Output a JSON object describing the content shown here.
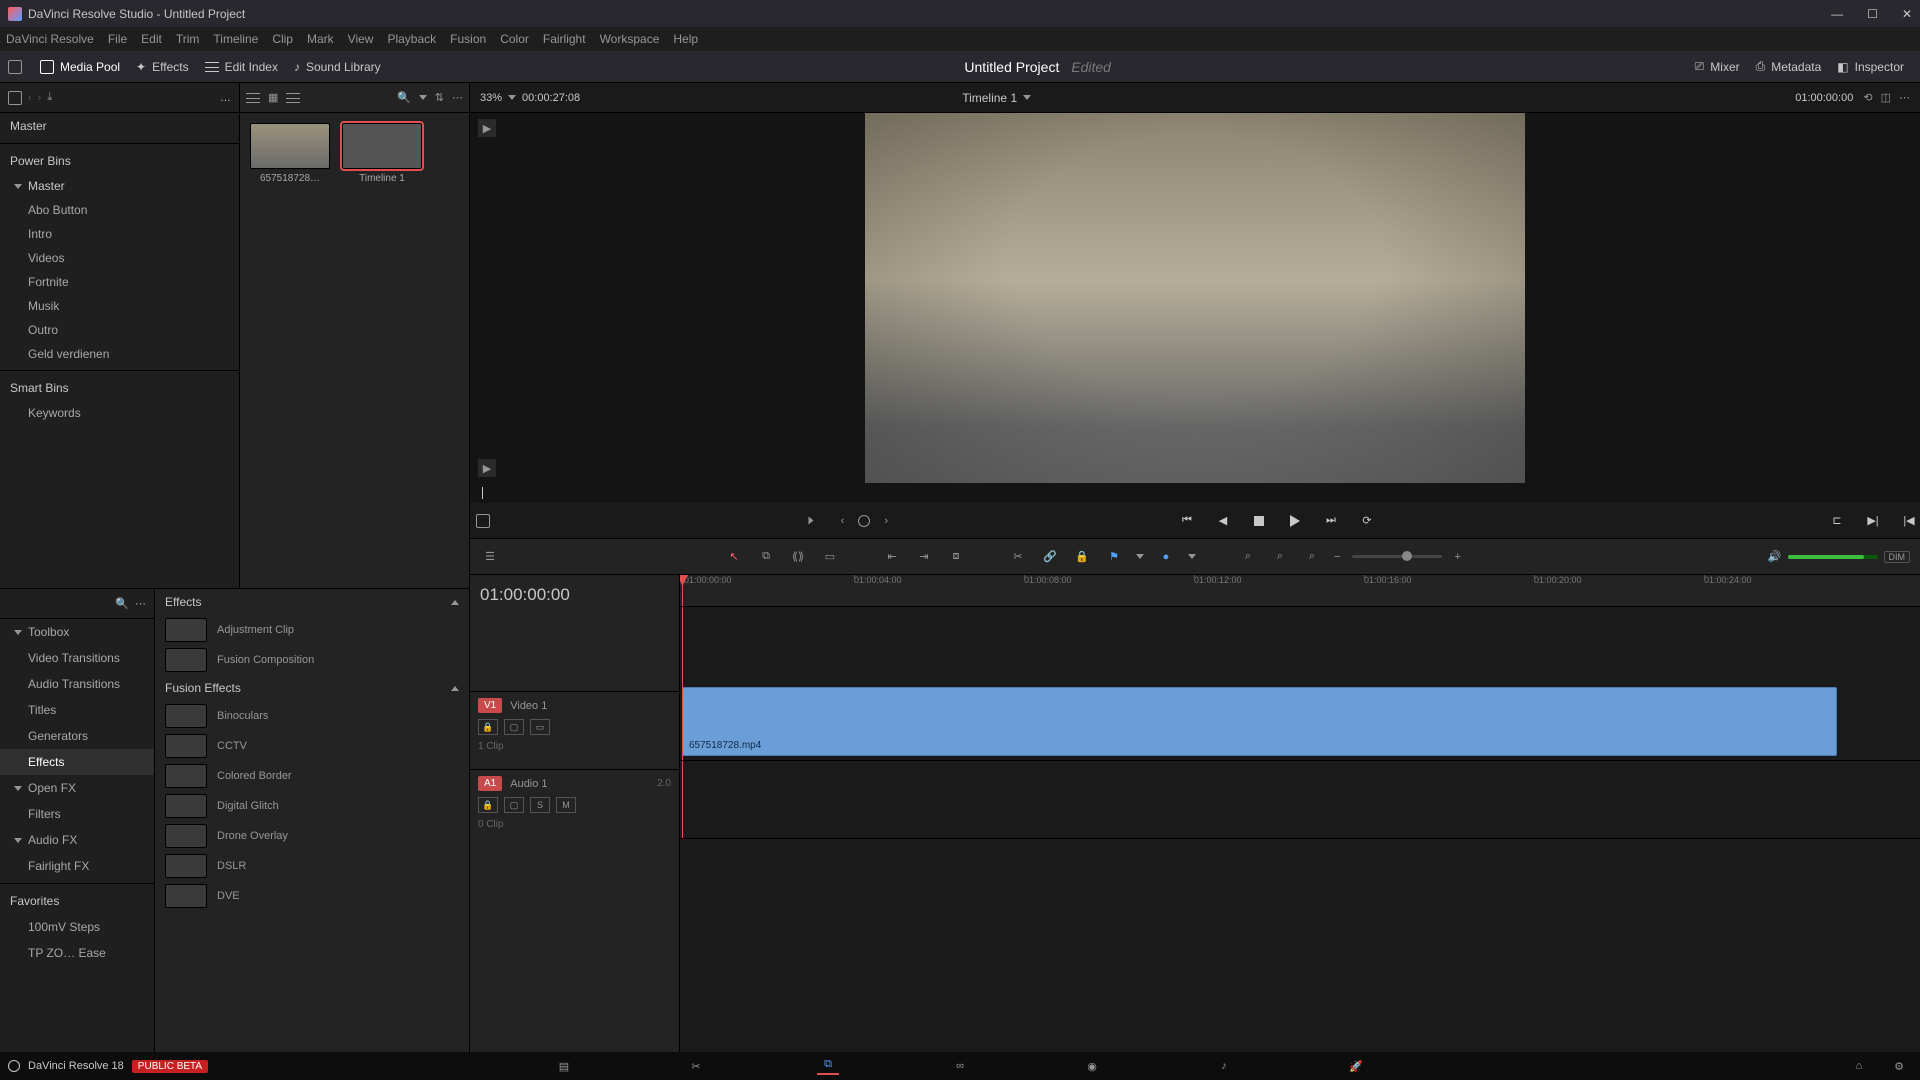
{
  "titlebar": {
    "text": "DaVinci Resolve Studio - Untitled Project"
  },
  "menu": [
    "DaVinci Resolve",
    "File",
    "Edit",
    "Trim",
    "Timeline",
    "Clip",
    "Mark",
    "View",
    "Playback",
    "Fusion",
    "Color",
    "Fairlight",
    "Workspace",
    "Help"
  ],
  "panel_tabs": {
    "left": [
      {
        "icon": "pool-icon",
        "label": "Media Pool",
        "active": true
      },
      {
        "icon": "fx-icon",
        "label": "Effects",
        "active": false
      },
      {
        "icon": "index-icon",
        "label": "Edit Index",
        "active": false
      },
      {
        "icon": "sound-icon",
        "label": "Sound Library",
        "active": false
      }
    ],
    "project_title": "Untitled Project",
    "project_status": "Edited",
    "right": [
      {
        "icon": "mixer-icon",
        "label": "Mixer"
      },
      {
        "icon": "metadata-icon",
        "label": "Metadata"
      },
      {
        "icon": "inspector-icon",
        "label": "Inspector"
      }
    ]
  },
  "left": {
    "master": "Master",
    "power": "Power Bins",
    "power_master": "Master",
    "bins": [
      "Abo Button",
      "Intro",
      "Videos",
      "Fortnite",
      "Musik",
      "Outro",
      "Geld verdienen"
    ],
    "smart": "Smart Bins",
    "keywords": "Keywords"
  },
  "fxnav": {
    "toolbox": "Toolbox",
    "toolbox_items": [
      "Video Transitions",
      "Audio Transitions",
      "Titles",
      "Generators",
      "Effects"
    ],
    "openfx": "Open FX",
    "openfx_items": [
      "Filters"
    ],
    "audiofx": "Audio FX",
    "audiofx_items": [
      "Fairlight FX"
    ],
    "favorites": "Favorites",
    "fav_items": [
      "100mV Steps",
      "TP ZO… Ease"
    ]
  },
  "fxlist": {
    "group1": "Effects",
    "group1_items": [
      "Adjustment Clip",
      "Fusion Composition"
    ],
    "group2": "Fusion Effects",
    "group2_items": [
      "Binoculars",
      "CCTV",
      "Colored Border",
      "Digital Glitch",
      "Drone Overlay",
      "DSLR",
      "DVE"
    ]
  },
  "pool": {
    "thumbs": [
      {
        "name": "657518728…",
        "sel": false
      },
      {
        "name": "Timeline 1",
        "sel": true,
        "timeline": true
      }
    ]
  },
  "viewerbar": {
    "zoom": "33%",
    "dur": "00:00:27:08",
    "timeline": "Timeline 1",
    "tc": "01:00:00:00"
  },
  "timeline": {
    "tc": "01:00:00:00",
    "ticks": [
      "01:00:00:00",
      "01:00:04:00",
      "01:00:08:00",
      "01:00:12:00",
      "01:00:16:00",
      "01:00:20:00",
      "01:00:24:00"
    ],
    "video": {
      "tag": "V1",
      "name": "Video 1",
      "clips": "1 Clip"
    },
    "audio": {
      "tag": "A1",
      "name": "Audio 1",
      "ch": "2.0",
      "clips": "0 Clip"
    },
    "clip_name": "657518728.mp4"
  },
  "footer": {
    "version": "DaVinci Resolve 18",
    "beta": "PUBLIC BETA"
  }
}
